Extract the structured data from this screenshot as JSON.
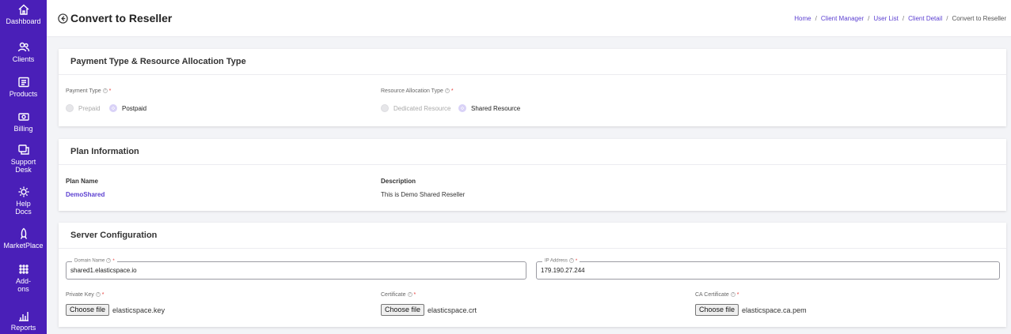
{
  "sidebar": {
    "items": [
      {
        "label": "Dashboard",
        "icon": "home-icon"
      },
      {
        "label": "Clients",
        "icon": "users-icon"
      },
      {
        "label": "Products",
        "icon": "products-icon"
      },
      {
        "label": "Billing",
        "icon": "billing-icon"
      },
      {
        "label": "Support",
        "label2": "Desk",
        "icon": "support-icon"
      },
      {
        "label": "Help",
        "label2": "Docs",
        "icon": "help-icon"
      },
      {
        "label": "MarketPlace",
        "icon": "marketplace-icon"
      },
      {
        "label": "Add-",
        "label2": "ons",
        "icon": "addons-icon"
      },
      {
        "label": "Reports",
        "icon": "reports-icon"
      }
    ]
  },
  "header": {
    "title": "Convert to Reseller",
    "breadcrumb": [
      "Home",
      "Client Manager",
      "User List",
      "Client Detail"
    ],
    "breadcrumb_current": "Convert to Reseller",
    "separator": "/"
  },
  "payment_card": {
    "title": "Payment Type & Resource Allocation Type",
    "payment_type_label": "Payment Type",
    "payment_options": [
      "Prepaid",
      "Postpaid"
    ],
    "payment_selected": "Postpaid",
    "resource_label": "Resource Allocation Type",
    "resource_options": [
      "Dedicated Resource",
      "Shared Resource"
    ],
    "resource_selected": "Shared Resource",
    "help_glyph": "?",
    "required_mark": "*"
  },
  "plan_card": {
    "title": "Plan Information",
    "plan_name_label": "Plan Name",
    "plan_name_value": "DemoShared",
    "description_label": "Description",
    "description_value": "This is Demo Shared Reseller"
  },
  "server_card": {
    "title": "Server Configuration",
    "domain_label": "Domain Name",
    "domain_value": "shared1.elasticspace.io",
    "ip_label": "IP Address",
    "ip_value": "179.190.27.244",
    "private_key_label": "Private Key",
    "certificate_label": "Certificate",
    "ca_certificate_label": "CA Certificate",
    "choose_file_label": "Choose file",
    "private_key_file": "elasticspace.key",
    "certificate_file": "elasticspace.crt",
    "ca_certificate_file": "elasticspace.ca.pem"
  },
  "colors": {
    "sidebar_bg": "#4a1fb8",
    "accent": "#5b3fd1",
    "required": "#e53935"
  }
}
